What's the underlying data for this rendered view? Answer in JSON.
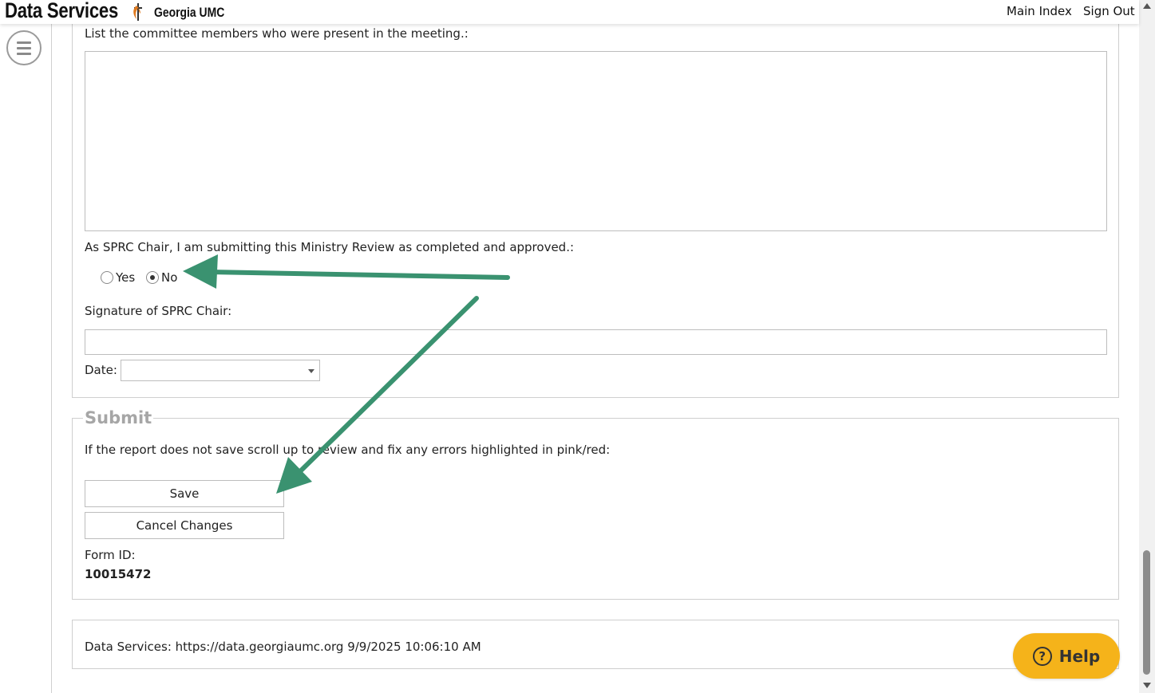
{
  "header": {
    "app_title": "Data Services",
    "org_name": "Georgia UMC",
    "main_index": "Main Index",
    "sign_out": "Sign Out"
  },
  "form": {
    "committee_label": "List the committee members who were present in the meeting.:",
    "committee_value": "",
    "approval_label": "As SPRC Chair, I am submitting this Ministry Review as completed and approved.:",
    "approval_options": [
      {
        "label": "Yes",
        "checked": false
      },
      {
        "label": "No",
        "checked": true
      }
    ],
    "signature_label": "Signature of SPRC Chair:",
    "signature_value": "",
    "date_label": "Date:",
    "date_value": ""
  },
  "submit": {
    "legend": "Submit",
    "instructions": "If the report does not save scroll up to review and fix any errors highlighted in pink/red:",
    "save_label": "Save",
    "cancel_label": "Cancel Changes",
    "form_id_label": "Form ID:",
    "form_id_value": "10015472"
  },
  "footer": {
    "text": "Data Services: https://data.georgiaumc.org 9/9/2025 10:06:10 AM"
  },
  "help": {
    "label": "Help",
    "icon": "question-circle-icon"
  },
  "colors": {
    "help_button": "#f5b31a",
    "annotation_arrow": "#3a9270",
    "legend_text": "#a6a6a6",
    "logo_cross": "#e07a1f"
  }
}
